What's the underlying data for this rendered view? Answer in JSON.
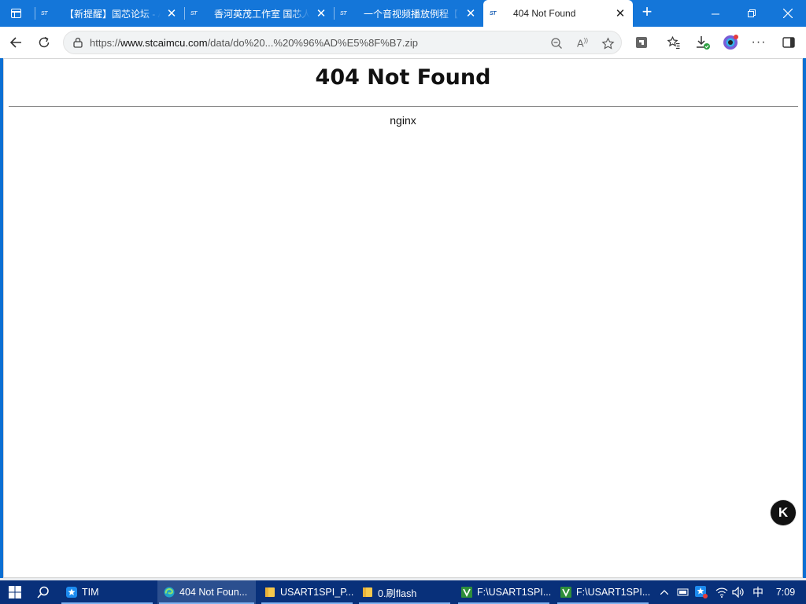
{
  "tabs": [
    {
      "favicon": "ST",
      "title": "【新提醒】国芯论坛 - AI"
    },
    {
      "favicon": "ST",
      "title": "香河英茂工作室 国芯人工"
    },
    {
      "favicon": "ST",
      "title": "一个音视频播放例程【U"
    },
    {
      "favicon": "ST",
      "title": "404 Not Found"
    }
  ],
  "address": {
    "url_prefix": "https://",
    "url_host": "www.stcaimcu.com",
    "url_path": "/data/do%20...%20%96%AD%E5%8F%B7.zip"
  },
  "page": {
    "heading": "404 Not Found",
    "server": "nginx",
    "floating_button": "K"
  },
  "taskbar": {
    "apps": [
      {
        "label": "TIM"
      },
      {
        "label": "404 Not Foun..."
      },
      {
        "label": "USART1SPI_P..."
      },
      {
        "label": "0.刷flash"
      },
      {
        "label": "F:\\USART1SPI..."
      },
      {
        "label": "F:\\USART1SPI..."
      }
    ],
    "ime": "中",
    "time": "7:09"
  },
  "colors": {
    "tabstrip": "#1476d9",
    "taskbar": "#08307a",
    "accent": "#0b6fd3"
  }
}
